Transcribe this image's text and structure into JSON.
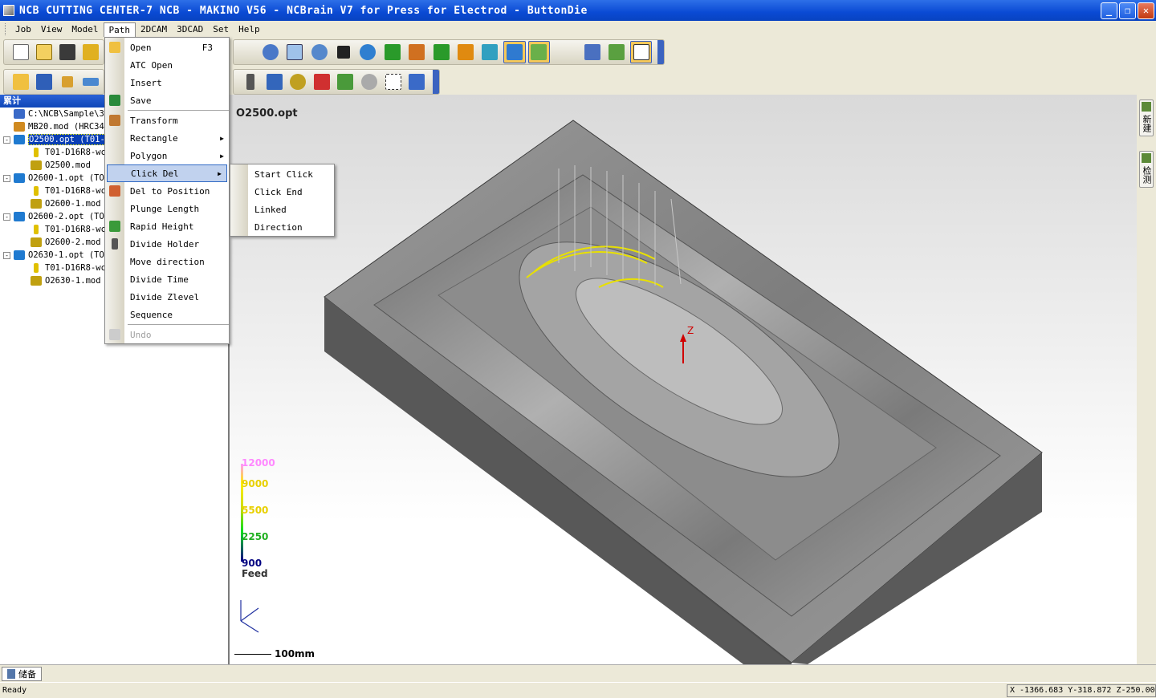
{
  "window": {
    "title": "NCB CUTTING CENTER-7 NCB - MAKINO V56 - NCBrain V7 for Press for Electrod - ButtonDie",
    "minimize": "_",
    "maximize": "❐",
    "close": "✕"
  },
  "menubar": [
    {
      "label": "Job"
    },
    {
      "label": "View"
    },
    {
      "label": "Model"
    },
    {
      "label": "Path"
    },
    {
      "label": "2DCAM"
    },
    {
      "label": "3DCAD"
    },
    {
      "label": "Set"
    },
    {
      "label": "Help"
    }
  ],
  "path_menu": [
    {
      "label": "Open",
      "shortcut": "F3",
      "icon": "open-folder-icon"
    },
    {
      "label": "ATC Open"
    },
    {
      "label": "Insert"
    },
    {
      "label": "Save",
      "icon": "save-disk-icon"
    },
    {
      "label": "Transform",
      "icon": "transform-icon"
    },
    {
      "label": "Rectangle",
      "submenu": true
    },
    {
      "label": "Polygon",
      "submenu": true
    },
    {
      "label": "Click Del",
      "submenu": true
    },
    {
      "label": "Del to Position",
      "icon": "eraser-icon"
    },
    {
      "label": "Plunge Length"
    },
    {
      "label": "Rapid Height",
      "icon": "rapid-icon"
    },
    {
      "label": "Divide Holder",
      "icon": "holder-icon"
    },
    {
      "label": "Move direction"
    },
    {
      "label": "Divide Time"
    },
    {
      "label": "Divide Zlevel"
    },
    {
      "label": "Sequence"
    },
    {
      "label": "Undo",
      "icon": "undo-icon"
    }
  ],
  "click_del_submenu": [
    {
      "label": "Start Click"
    },
    {
      "label": "Click End"
    },
    {
      "label": "Linked"
    },
    {
      "label": "Direction"
    }
  ],
  "tree": {
    "header": "累计",
    "items": [
      {
        "label": "C:\\NCB\\Sample\\3",
        "indent": 1
      },
      {
        "label": "MB20.mod (HRC34",
        "indent": 1
      },
      {
        "label": "O2500.opt (T01-",
        "indent": 1,
        "selected": true,
        "expander": "-"
      },
      {
        "label": "T01-D16R8-wc",
        "indent": 2
      },
      {
        "label": "O2500.mod",
        "indent": 2
      },
      {
        "label": "O2600-1.opt (TO",
        "indent": 1,
        "expander": "-"
      },
      {
        "label": "T01-D16R8-wc",
        "indent": 2
      },
      {
        "label": "O2600-1.mod",
        "indent": 2
      },
      {
        "label": "O2600-2.opt (TO",
        "indent": 1,
        "expander": "-"
      },
      {
        "label": "T01-D16R8-wc",
        "indent": 2
      },
      {
        "label": "O2600-2.mod",
        "indent": 2
      },
      {
        "label": "O2630-1.opt (TO",
        "indent": 1,
        "expander": "-"
      },
      {
        "label": "T01-D16R8-wc",
        "indent": 2
      },
      {
        "label": "O2630-1.mod",
        "indent": 2
      }
    ]
  },
  "viewport": {
    "title": "O2500.opt",
    "legend": {
      "values": [
        "12000",
        "9000",
        "5500",
        "2250",
        "900"
      ],
      "label": "Feed"
    },
    "scale": "100mm",
    "axis_z": "Z"
  },
  "side_tabs": [
    "新建",
    "检测"
  ],
  "bottom_tab": "储备",
  "status": {
    "text": "Ready",
    "coords": "X -1366.683 Y-318.872 Z-250.000"
  },
  "colors": {
    "title_bar": "#0a4ad4",
    "menu_highlight": "#c1d2ee",
    "tree_selected": "#0a3fb5",
    "toolpath": "#e8e000"
  }
}
